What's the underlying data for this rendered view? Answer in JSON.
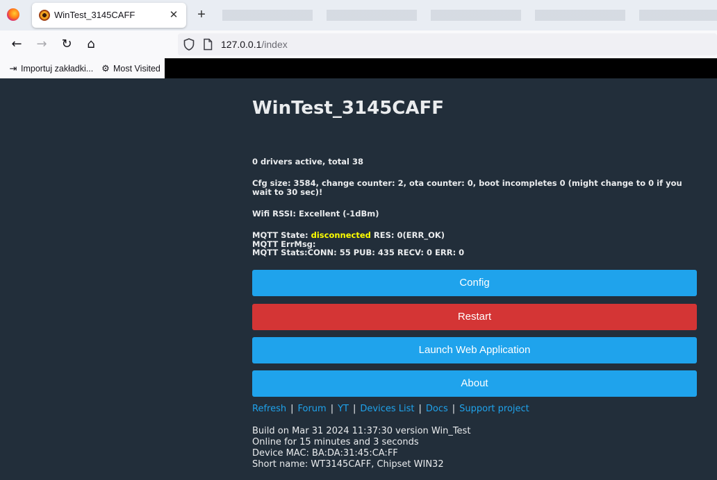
{
  "browser": {
    "tab_title": "WinTest_3145CAFF",
    "tab_close": "✕",
    "new_tab": "+",
    "nav": {
      "back": "←",
      "forward": "→",
      "reload": "↻",
      "home": "⌂"
    },
    "url_host": "127.0.0.1",
    "url_path": "/index",
    "bookmarks": [
      {
        "label": "Importuj zakładki...",
        "icon": "import-icon"
      },
      {
        "label": "Most Visited",
        "icon": "gear-icon"
      }
    ]
  },
  "page": {
    "title": "WinTest_3145CAFF",
    "drivers": "0 drivers active, total 38",
    "cfg_line": "Cfg size: 3584, change counter: 2, ota counter: 0, boot incompletes 0 (might change to 0 if you wait to 30 sec)!",
    "wifi": "Wifi RSSI: Excellent (-1dBm)",
    "mqtt": {
      "state_prefix": "MQTT State: ",
      "state_value": "disconnected",
      "state_suffix": " RES: 0(ERR_OK)",
      "errmsg": "MQTT ErrMsg:",
      "stats": "MQTT Stats:CONN: 55 PUB: 435 RECV: 0 ERR: 0"
    },
    "buttons": {
      "config": "Config",
      "restart": "Restart",
      "launch": "Launch Web Application",
      "about": "About"
    },
    "links": [
      "Refresh",
      "Forum",
      "YT",
      "Devices List",
      "Docs",
      "Support project"
    ],
    "link_separator": "|",
    "build": [
      "Build on Mar 31 2024 11:37:30 version Win_Test",
      "Online for 15 minutes and 3 seconds",
      "Device MAC: BA:DA:31:45:CA:FF",
      "Short name: WT3145CAFF, Chipset WIN32"
    ]
  },
  "colors": {
    "background": "#222e3a",
    "button_blue": "#1fa3ec",
    "button_red": "#d43535",
    "status_yellow": "#ffff00"
  }
}
